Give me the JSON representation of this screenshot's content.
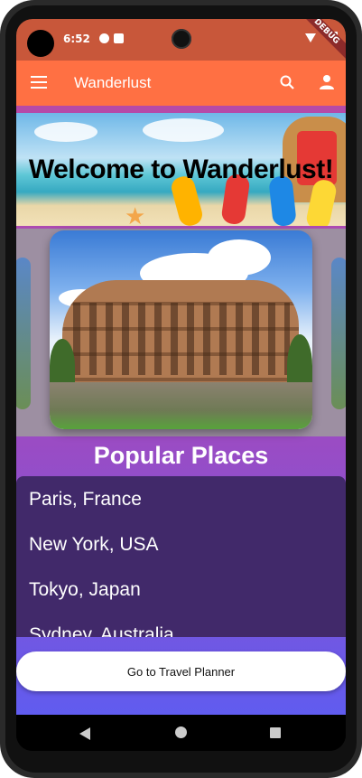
{
  "status_bar": {
    "time": "6:52",
    "debug_ribbon": "DEBUG"
  },
  "app_bar": {
    "title": "Wanderlust",
    "color": "#ff7043",
    "icons": [
      "menu-icon",
      "search-icon",
      "person-icon"
    ]
  },
  "banner": {
    "welcome_text": "Welcome to Wanderlust!"
  },
  "carousel": {
    "current_image": "colosseum-photo"
  },
  "popular": {
    "title": "Popular Places",
    "places": [
      "Paris, France",
      "New York, USA",
      "Tokyo, Japan",
      "Sydney, Australia"
    ]
  },
  "planner_button": {
    "label": "Go to Travel Planner"
  },
  "colors": {
    "accent": "#ff7043",
    "status_bar": "#c8573a",
    "list_background": "#41296a",
    "gradient_top": "#b64aa7",
    "gradient_bottom": "#5f5cf0"
  }
}
